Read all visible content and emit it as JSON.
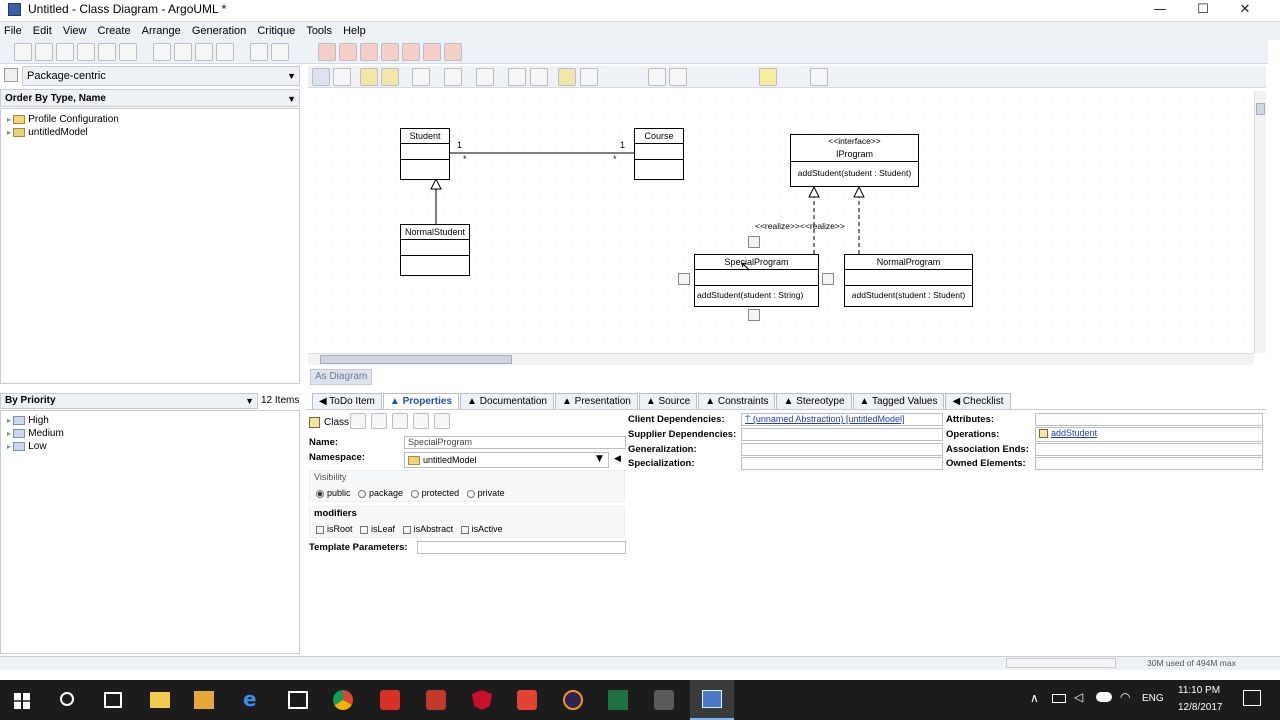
{
  "window": {
    "title": "Untitled - Class Diagram - ArgoUML *"
  },
  "menu": [
    "File",
    "Edit",
    "View",
    "Create",
    "Arrange",
    "Generation",
    "Critique",
    "Tools",
    "Help"
  ],
  "explorer": {
    "perspective": "Package-centric",
    "order": "Order By Type, Name",
    "tree": [
      "Profile Configuration",
      "untitledModel"
    ]
  },
  "todo": {
    "mode": "By Priority",
    "count": "12 Items",
    "items": [
      "High",
      "Medium",
      "Low"
    ]
  },
  "diagram": {
    "tab": "As Diagram",
    "classes": {
      "student": "Student",
      "course": "Course",
      "normal_student": "NormalStudent",
      "iprogram_stereo": "<<interface>>",
      "iprogram": "IProgram",
      "iprogram_op": "addStudent(student : Student)",
      "special_program": "SpecialProgram",
      "special_program_op": "addStudent(student : String)",
      "normal_program": "NormalProgram",
      "normal_program_op": "addStudent(student : Student)"
    },
    "assoc": {
      "left_mult_top": "1",
      "left_mult_bottom": "*",
      "right_mult_top": "1",
      "right_mult_bottom": "*"
    },
    "realize_label": "<<realize>><<realize>>"
  },
  "details": {
    "tabs": [
      "ToDo Item",
      "Properties",
      "Documentation",
      "Presentation",
      "Source",
      "Constraints",
      "Stereotype",
      "Tagged Values",
      "Checklist"
    ],
    "element_type": "Class",
    "name_label": "Name:",
    "name_value": "SpecialProgram",
    "namespace_label": "Namespace:",
    "namespace_value": "untitledModel",
    "visibility_label": "Visibility",
    "visibility": [
      "public",
      "package",
      "protected",
      "private"
    ],
    "modifiers_label": "modifiers",
    "modifiers": [
      "isRoot",
      "isLeaf",
      "isAbstract",
      "isActive"
    ],
    "template_label": "Template Parameters:",
    "client_dep_label": "Client Dependencies:",
    "client_dep_value": "(unnamed Abstraction) [untitledModel]",
    "supplier_dep_label": "Supplier Dependencies:",
    "generalization_label": "Generalization:",
    "specialization_label": "Specialization:",
    "attributes_label": "Attributes:",
    "operations_label": "Operations:",
    "operations_value": "addStudent",
    "assoc_ends_label": "Association Ends:",
    "owned_label": "Owned Elements:"
  },
  "status": {
    "memory": "30M used of 494M max"
  },
  "taskbar": {
    "lang": "ENG",
    "time": "11:10 PM",
    "date": "12/8/2017"
  }
}
